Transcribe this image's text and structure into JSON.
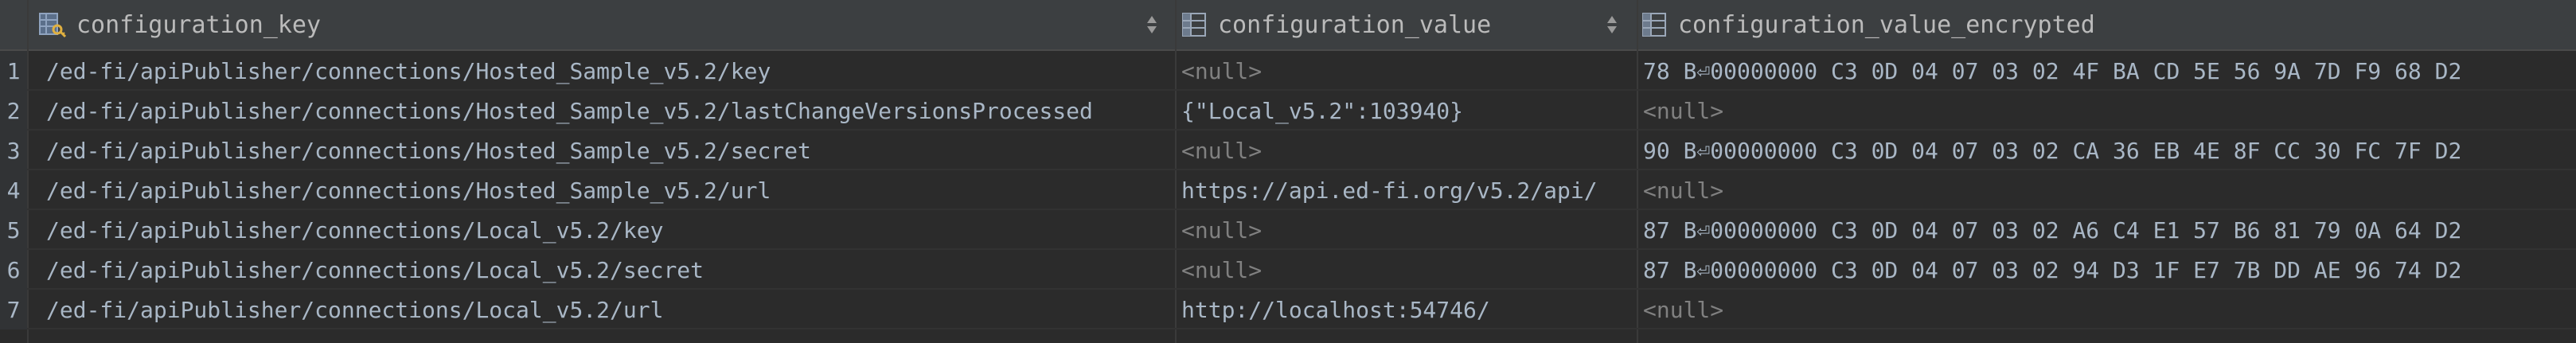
{
  "columns": [
    {
      "label": "configuration_key",
      "icon": "key-column-icon"
    },
    {
      "label": "configuration_value",
      "icon": "table-column-icon"
    },
    {
      "label": "configuration_value_encrypted",
      "icon": "table-column-icon"
    }
  ],
  "rows": [
    {
      "num": "1",
      "key": "/ed-fi/apiPublisher/connections/Hosted_Sample_v5.2/key",
      "value": "<null>",
      "value_null": true,
      "encrypted": "78 B⏎00000000  C3 0D 04 07 03 02 4F BA CD 5E 56 9A 7D F9 68 D2",
      "encrypted_null": false
    },
    {
      "num": "2",
      "key": "/ed-fi/apiPublisher/connections/Hosted_Sample_v5.2/lastChangeVersionsProcessed",
      "value": "{\"Local_v5.2\":103940}",
      "value_null": false,
      "encrypted": "<null>",
      "encrypted_null": true
    },
    {
      "num": "3",
      "key": "/ed-fi/apiPublisher/connections/Hosted_Sample_v5.2/secret",
      "value": "<null>",
      "value_null": true,
      "encrypted": "90 B⏎00000000  C3 0D 04 07 03 02 CA 36 EB 4E 8F CC 30 FC 7F D2",
      "encrypted_null": false
    },
    {
      "num": "4",
      "key": "/ed-fi/apiPublisher/connections/Hosted_Sample_v5.2/url",
      "value": "https://api.ed-fi.org/v5.2/api/",
      "value_null": false,
      "encrypted": "<null>",
      "encrypted_null": true
    },
    {
      "num": "5",
      "key": "/ed-fi/apiPublisher/connections/Local_v5.2/key",
      "value": "<null>",
      "value_null": true,
      "encrypted": "87 B⏎00000000  C3 0D 04 07 03 02 A6 C4 E1 57 B6 81 79 0A 64 D2",
      "encrypted_null": false
    },
    {
      "num": "6",
      "key": "/ed-fi/apiPublisher/connections/Local_v5.2/secret",
      "value": "<null>",
      "value_null": true,
      "encrypted": "87 B⏎00000000  C3 0D 04 07 03 02 94 D3 1F E7 7B DD AE 96 74 D2",
      "encrypted_null": false
    },
    {
      "num": "7",
      "key": "/ed-fi/apiPublisher/connections/Local_v5.2/url",
      "value": "http://localhost:54746/",
      "value_null": false,
      "encrypted": "<null>",
      "encrypted_null": true
    }
  ],
  "colors": {
    "background": "#2b2b2b",
    "header": "#3c3f41",
    "text": "#a9b7c6",
    "null_text": "#808080"
  }
}
